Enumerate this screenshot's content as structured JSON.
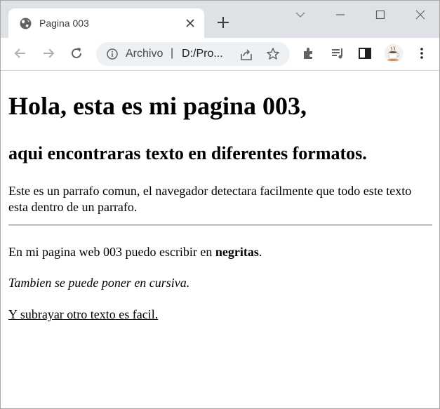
{
  "browser": {
    "tab": {
      "title": "Pagina 003",
      "favicon": "globe-icon"
    },
    "omnibox": {
      "origin_label": "Archivo",
      "separator": "|",
      "url": "D:/Pro..."
    },
    "colors": {
      "titlebar": "#dee1e6",
      "omnibox": "#eef1f4",
      "icon": "#5f6368"
    }
  },
  "page": {
    "heading1": "Hola, esta es mi pagina 003,",
    "heading2": "aqui encontraras texto en diferentes formatos.",
    "paragraph": "Este es un parrafo comun, el navegador detectara facilmente que todo este texto esta dentro de un parrafo.",
    "bold_prefix": "En mi pagina web 003 puedo escribir en ",
    "bold_word": "negritas",
    "bold_suffix": ".",
    "italic_text": "Tambien se puede poner en cursiva.",
    "underline_text": "Y subrayar otro texto es facil."
  }
}
